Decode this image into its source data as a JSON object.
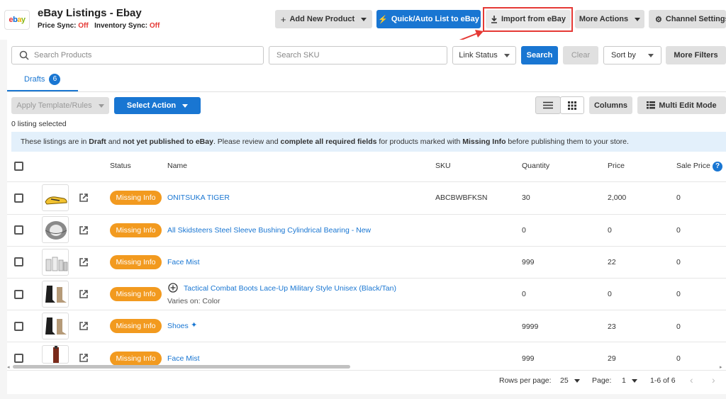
{
  "header": {
    "logo": [
      "e",
      "b",
      "a",
      "y"
    ],
    "title": "eBay Listings - Ebay",
    "price_sync_label": "Price Sync:",
    "price_sync_value": "Off",
    "inventory_sync_label": "Inventory Sync:",
    "inventory_sync_value": "Off"
  },
  "toolbar": {
    "add_new_product": "Add New Product",
    "quick_list": "Quick/Auto List to eBay",
    "import": "Import from eBay",
    "more_actions": "More Actions",
    "channel_settings": "Channel Settings"
  },
  "filters": {
    "search_placeholder": "Search Products",
    "sku_placeholder": "Search SKU",
    "link_status": "Link Status",
    "search_button": "Search",
    "clear_button": "Clear",
    "sort_by": "Sort by",
    "more_filters": "More Filters"
  },
  "tabs": [
    {
      "label": "Drafts",
      "count": "6"
    }
  ],
  "actions": {
    "apply_template": "Apply Template/Rules",
    "select_action": "Select Action",
    "columns": "Columns",
    "multi_edit": "Multi Edit Mode"
  },
  "selection": {
    "text": "0 listing selected"
  },
  "banner": {
    "parts": [
      {
        "t": "These listings are in ",
        "b": false
      },
      {
        "t": "Draft",
        "b": true
      },
      {
        "t": " and ",
        "b": false
      },
      {
        "t": "not yet published to eBay",
        "b": true
      },
      {
        "t": ". Please review and ",
        "b": false
      },
      {
        "t": "complete all required fields",
        "b": true
      },
      {
        "t": " for products marked with ",
        "b": false
      },
      {
        "t": "Missing Info",
        "b": true
      },
      {
        "t": " before publishing them to your store.",
        "b": false
      }
    ]
  },
  "table": {
    "headers": {
      "status": "Status",
      "name": "Name",
      "sku": "SKU",
      "quantity": "Quantity",
      "price": "Price",
      "sale_price": "Sale Price"
    },
    "rows": [
      {
        "status": "Missing Info",
        "name": "ONITSUKA TIGER",
        "sku": "ABCBWBFKSN",
        "quantity": "30",
        "price": "2,000",
        "sale_price": "0",
        "thumb": "shoe-yellow"
      },
      {
        "status": "Missing Info",
        "name": "All Skidsteers Steel Sleeve Bushing Cylindrical Bearing - New",
        "sku": "",
        "quantity": "0",
        "price": "0",
        "sale_price": "0",
        "thumb": "bearing"
      },
      {
        "status": "Missing Info",
        "name": "Face Mist",
        "sku": "",
        "quantity": "999",
        "price": "22",
        "sale_price": "0",
        "thumb": "bottles"
      },
      {
        "status": "Missing Info",
        "name": "Tactical Combat Boots Lace-Up Military Style Unisex (Black/Tan)",
        "sub": "Varies on: Color",
        "sku": "",
        "quantity": "0",
        "price": "0",
        "sale_price": "0",
        "thumb": "boots"
      },
      {
        "status": "Missing Info",
        "name": "Shoes",
        "sku": "",
        "quantity": "9999",
        "price": "23",
        "sale_price": "0",
        "thumb": "boots"
      },
      {
        "status": "Missing Info",
        "name": "Face Mist",
        "sku": "",
        "quantity": "999",
        "price": "29",
        "sale_price": "0",
        "thumb": "bottle-dark"
      }
    ]
  },
  "pagination": {
    "rows_per_page_label": "Rows per page:",
    "rows_per_page": "25",
    "page_label": "Page:",
    "page": "1",
    "range": "1-6 of 6"
  },
  "colors": {
    "primary": "#1976d2",
    "missing_badge": "#f29a1f",
    "highlight": "#e53935",
    "banner_bg": "#e3f0fb"
  }
}
